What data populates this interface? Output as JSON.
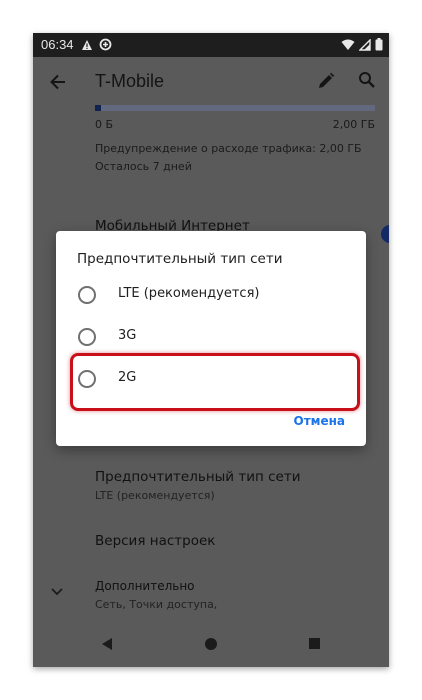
{
  "status_bar": {
    "time": "06:34",
    "left_icons": [
      "warning-icon",
      "data-saver-icon"
    ],
    "right_icons": [
      "wifi-icon",
      "cell-signal-icon",
      "battery-icon"
    ]
  },
  "app_bar": {
    "title": "T-Mobile",
    "icons": [
      "back-arrow-icon",
      "edit-icon",
      "search-icon"
    ]
  },
  "usage": {
    "min_label": "0 Б",
    "max_label": "2,00 ГБ",
    "fill_fraction": 0.02,
    "warning": "Предупреждение о расходе трафика: 2,00 ГБ",
    "days_left": "Осталось 7 дней"
  },
  "settings": {
    "mobile_internet": "Мобильный Интернет",
    "preferred_network_title": "Предпочтительный тип сети",
    "preferred_network_value": "LTE (рекомендуется)",
    "settings_version": "Версия настроек",
    "advanced_title": "Дополнительно",
    "advanced_sub": "Сеть, Точки доступа,"
  },
  "dialog": {
    "title": "Предпочтительный тип сети",
    "options": [
      {
        "label": "LTE (рекомендуется)"
      },
      {
        "label": "3G"
      },
      {
        "label": "2G"
      }
    ],
    "cancel_label": "Отмена"
  },
  "colors": {
    "accent": "#1a73e8",
    "highlight": "#c8101a",
    "scrim": "#5a5a5a"
  }
}
